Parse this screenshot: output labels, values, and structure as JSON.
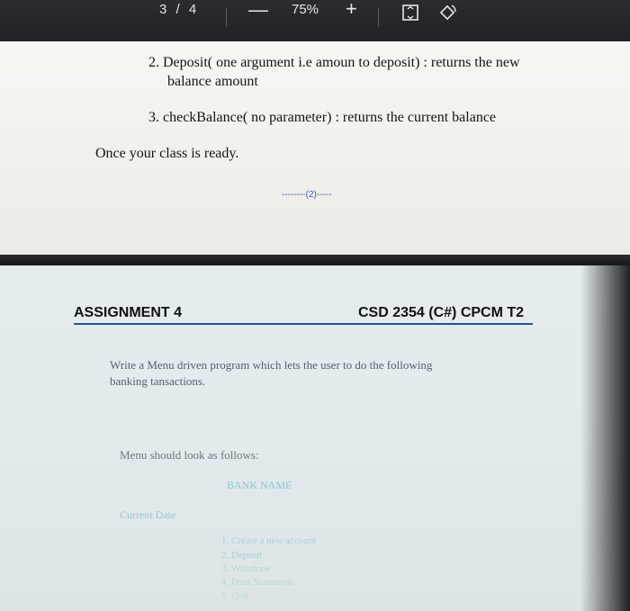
{
  "toolbar": {
    "page_current": "3",
    "page_sep": "/",
    "page_total": "4",
    "zoom_out": "—",
    "zoom_level": "75%",
    "zoom_in": "+",
    "icons": [
      "fit-page-icon",
      "rotate-icon"
    ]
  },
  "page1": {
    "item2_line1": "2.  Deposit( one argument  i.e amoun to deposit) : returns the new",
    "item2_line2": "balance amount",
    "item3": "3.  checkBalance( no parameter) : returns the current balance",
    "once_ready": "Once your class is ready.",
    "page_number": "--------(2)-----"
  },
  "page2": {
    "assignment": "ASSIGNMENT 4",
    "course": "CSD 2354 (C#)  CPCM T2",
    "intro_line1": "Write a  Menu driven program which lets the user to do the following",
    "intro_line2": "banking tansactions.",
    "menu_intro": "Menu should look as follows:",
    "bank_name": "BANK NAME",
    "current_date": "Current Date",
    "menu_items": [
      "1. Create a new account",
      "2. Deposit",
      "3. Withdraw",
      "4. Print Statement",
      "5. Quit"
    ]
  },
  "colors": {
    "link_blue": "#2e4f8c",
    "faint_cyan": "#7fc6cf"
  }
}
